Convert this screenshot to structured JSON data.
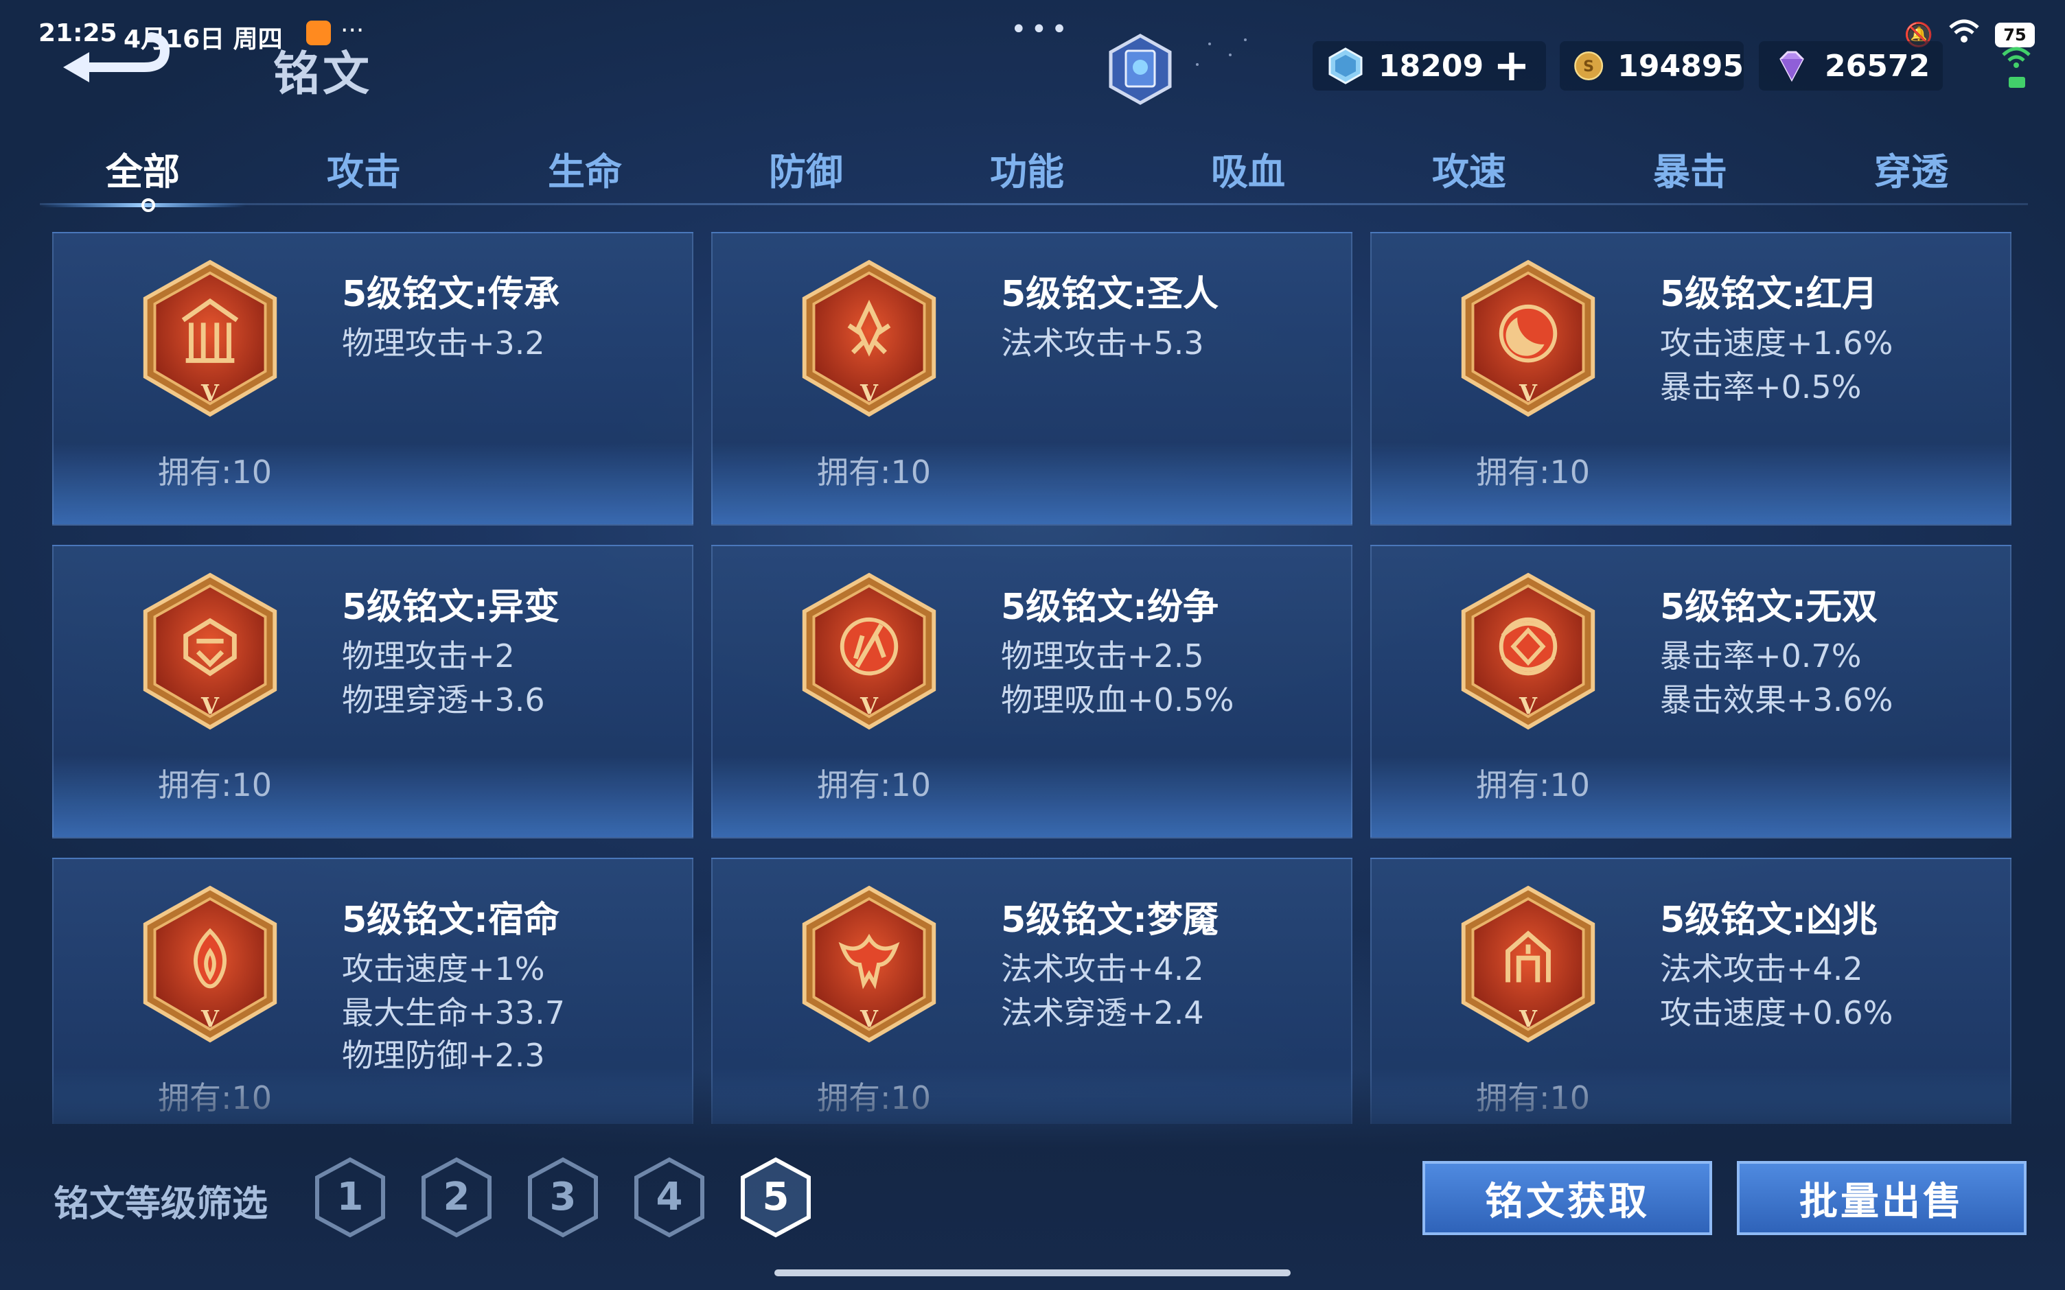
{
  "status_bar": {
    "time": "21:25",
    "date": "4月16日 周四",
    "more": "···",
    "battery": "75"
  },
  "header": {
    "title": "铭文",
    "dots": "•••"
  },
  "currencies": [
    {
      "icon": "crystal-icon",
      "value": "18209",
      "plus": "+"
    },
    {
      "icon": "gold-coin-icon",
      "value": "194895"
    },
    {
      "icon": "diamond-icon",
      "value": "26572"
    }
  ],
  "tabs": [
    {
      "label": "全部",
      "active": true
    },
    {
      "label": "攻击"
    },
    {
      "label": "生命"
    },
    {
      "label": "防御"
    },
    {
      "label": "功能"
    },
    {
      "label": "吸血"
    },
    {
      "label": "攻速"
    },
    {
      "label": "暴击"
    },
    {
      "label": "穿透"
    }
  ],
  "inscriptions": [
    {
      "name": "5级铭文:传承",
      "attrs": [
        "物理攻击+3.2"
      ],
      "owned": "拥有:10",
      "icon": "pillar-rune-icon"
    },
    {
      "name": "5级铭文:圣人",
      "attrs": [
        "法术攻击+5.3"
      ],
      "owned": "拥有:10",
      "icon": "crystal-rune-icon"
    },
    {
      "name": "5级铭文:红月",
      "attrs": [
        "攻击速度+1.6%",
        "暴击率+0.5%"
      ],
      "owned": "拥有:10",
      "icon": "crescent-moon-rune-icon"
    },
    {
      "name": "5级铭文:异变",
      "attrs": [
        "物理攻击+2",
        "物理穿透+3.6"
      ],
      "owned": "拥有:10",
      "icon": "shield-rune-icon"
    },
    {
      "name": "5级铭文:纷争",
      "attrs": [
        "物理攻击+2.5",
        "物理吸血+0.5%"
      ],
      "owned": "拥有:10",
      "icon": "blade-rune-icon"
    },
    {
      "name": "5级铭文:无双",
      "attrs": [
        "暴击率+0.7%",
        "暴击效果+3.6%"
      ],
      "owned": "拥有:10",
      "icon": "vortex-rune-icon"
    },
    {
      "name": "5级铭文:宿命",
      "attrs": [
        "攻击速度+1%",
        "最大生命+33.7",
        "物理防御+2.3"
      ],
      "owned": "拥有:10",
      "icon": "flame-rune-icon"
    },
    {
      "name": "5级铭文:梦魇",
      "attrs": [
        "法术攻击+4.2",
        "法术穿透+2.4"
      ],
      "owned": "拥有:10",
      "icon": "bat-rune-icon"
    },
    {
      "name": "5级铭文:凶兆",
      "attrs": [
        "法术攻击+4.2",
        "攻击速度+0.6%"
      ],
      "owned": "拥有:10",
      "icon": "gate-rune-icon"
    }
  ],
  "badge_level": "V",
  "filter": {
    "label": "铭文等级筛选",
    "levels": [
      "1",
      "2",
      "3",
      "4",
      "5"
    ],
    "selected": "5"
  },
  "actions": {
    "acquire": "铭文获取",
    "bulk_sell": "批量出售"
  },
  "colors": {
    "tab_active": "#ffffff",
    "tab_inactive": "#7fb2ee",
    "badge_red": "#c8451f",
    "badge_gold": "#e0a35a",
    "button_blue": "#3f74cc"
  }
}
